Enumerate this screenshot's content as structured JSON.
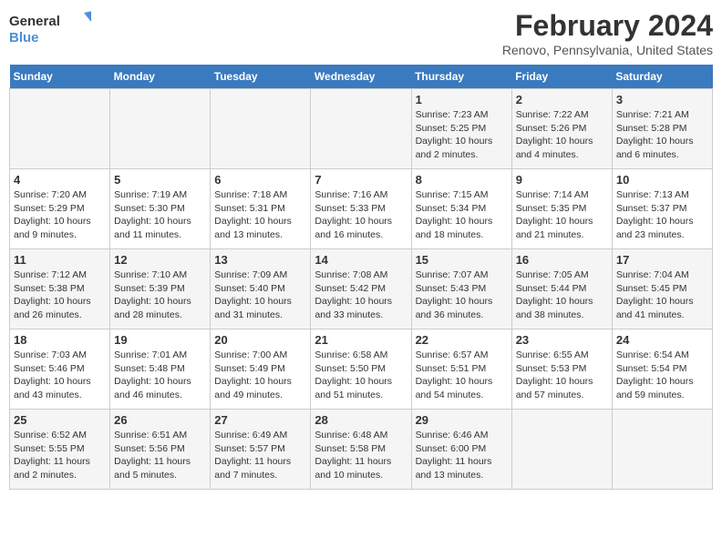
{
  "header": {
    "logo_line1": "General",
    "logo_line2": "Blue",
    "title": "February 2024",
    "subtitle": "Renovo, Pennsylvania, United States"
  },
  "weekdays": [
    "Sunday",
    "Monday",
    "Tuesday",
    "Wednesday",
    "Thursday",
    "Friday",
    "Saturday"
  ],
  "weeks": [
    [
      {
        "day": "",
        "info": ""
      },
      {
        "day": "",
        "info": ""
      },
      {
        "day": "",
        "info": ""
      },
      {
        "day": "",
        "info": ""
      },
      {
        "day": "1",
        "info": "Sunrise: 7:23 AM\nSunset: 5:25 PM\nDaylight: 10 hours\nand 2 minutes."
      },
      {
        "day": "2",
        "info": "Sunrise: 7:22 AM\nSunset: 5:26 PM\nDaylight: 10 hours\nand 4 minutes."
      },
      {
        "day": "3",
        "info": "Sunrise: 7:21 AM\nSunset: 5:28 PM\nDaylight: 10 hours\nand 6 minutes."
      }
    ],
    [
      {
        "day": "4",
        "info": "Sunrise: 7:20 AM\nSunset: 5:29 PM\nDaylight: 10 hours\nand 9 minutes."
      },
      {
        "day": "5",
        "info": "Sunrise: 7:19 AM\nSunset: 5:30 PM\nDaylight: 10 hours\nand 11 minutes."
      },
      {
        "day": "6",
        "info": "Sunrise: 7:18 AM\nSunset: 5:31 PM\nDaylight: 10 hours\nand 13 minutes."
      },
      {
        "day": "7",
        "info": "Sunrise: 7:16 AM\nSunset: 5:33 PM\nDaylight: 10 hours\nand 16 minutes."
      },
      {
        "day": "8",
        "info": "Sunrise: 7:15 AM\nSunset: 5:34 PM\nDaylight: 10 hours\nand 18 minutes."
      },
      {
        "day": "9",
        "info": "Sunrise: 7:14 AM\nSunset: 5:35 PM\nDaylight: 10 hours\nand 21 minutes."
      },
      {
        "day": "10",
        "info": "Sunrise: 7:13 AM\nSunset: 5:37 PM\nDaylight: 10 hours\nand 23 minutes."
      }
    ],
    [
      {
        "day": "11",
        "info": "Sunrise: 7:12 AM\nSunset: 5:38 PM\nDaylight: 10 hours\nand 26 minutes."
      },
      {
        "day": "12",
        "info": "Sunrise: 7:10 AM\nSunset: 5:39 PM\nDaylight: 10 hours\nand 28 minutes."
      },
      {
        "day": "13",
        "info": "Sunrise: 7:09 AM\nSunset: 5:40 PM\nDaylight: 10 hours\nand 31 minutes."
      },
      {
        "day": "14",
        "info": "Sunrise: 7:08 AM\nSunset: 5:42 PM\nDaylight: 10 hours\nand 33 minutes."
      },
      {
        "day": "15",
        "info": "Sunrise: 7:07 AM\nSunset: 5:43 PM\nDaylight: 10 hours\nand 36 minutes."
      },
      {
        "day": "16",
        "info": "Sunrise: 7:05 AM\nSunset: 5:44 PM\nDaylight: 10 hours\nand 38 minutes."
      },
      {
        "day": "17",
        "info": "Sunrise: 7:04 AM\nSunset: 5:45 PM\nDaylight: 10 hours\nand 41 minutes."
      }
    ],
    [
      {
        "day": "18",
        "info": "Sunrise: 7:03 AM\nSunset: 5:46 PM\nDaylight: 10 hours\nand 43 minutes."
      },
      {
        "day": "19",
        "info": "Sunrise: 7:01 AM\nSunset: 5:48 PM\nDaylight: 10 hours\nand 46 minutes."
      },
      {
        "day": "20",
        "info": "Sunrise: 7:00 AM\nSunset: 5:49 PM\nDaylight: 10 hours\nand 49 minutes."
      },
      {
        "day": "21",
        "info": "Sunrise: 6:58 AM\nSunset: 5:50 PM\nDaylight: 10 hours\nand 51 minutes."
      },
      {
        "day": "22",
        "info": "Sunrise: 6:57 AM\nSunset: 5:51 PM\nDaylight: 10 hours\nand 54 minutes."
      },
      {
        "day": "23",
        "info": "Sunrise: 6:55 AM\nSunset: 5:53 PM\nDaylight: 10 hours\nand 57 minutes."
      },
      {
        "day": "24",
        "info": "Sunrise: 6:54 AM\nSunset: 5:54 PM\nDaylight: 10 hours\nand 59 minutes."
      }
    ],
    [
      {
        "day": "25",
        "info": "Sunrise: 6:52 AM\nSunset: 5:55 PM\nDaylight: 11 hours\nand 2 minutes."
      },
      {
        "day": "26",
        "info": "Sunrise: 6:51 AM\nSunset: 5:56 PM\nDaylight: 11 hours\nand 5 minutes."
      },
      {
        "day": "27",
        "info": "Sunrise: 6:49 AM\nSunset: 5:57 PM\nDaylight: 11 hours\nand 7 minutes."
      },
      {
        "day": "28",
        "info": "Sunrise: 6:48 AM\nSunset: 5:58 PM\nDaylight: 11 hours\nand 10 minutes."
      },
      {
        "day": "29",
        "info": "Sunrise: 6:46 AM\nSunset: 6:00 PM\nDaylight: 11 hours\nand 13 minutes."
      },
      {
        "day": "",
        "info": ""
      },
      {
        "day": "",
        "info": ""
      }
    ]
  ]
}
